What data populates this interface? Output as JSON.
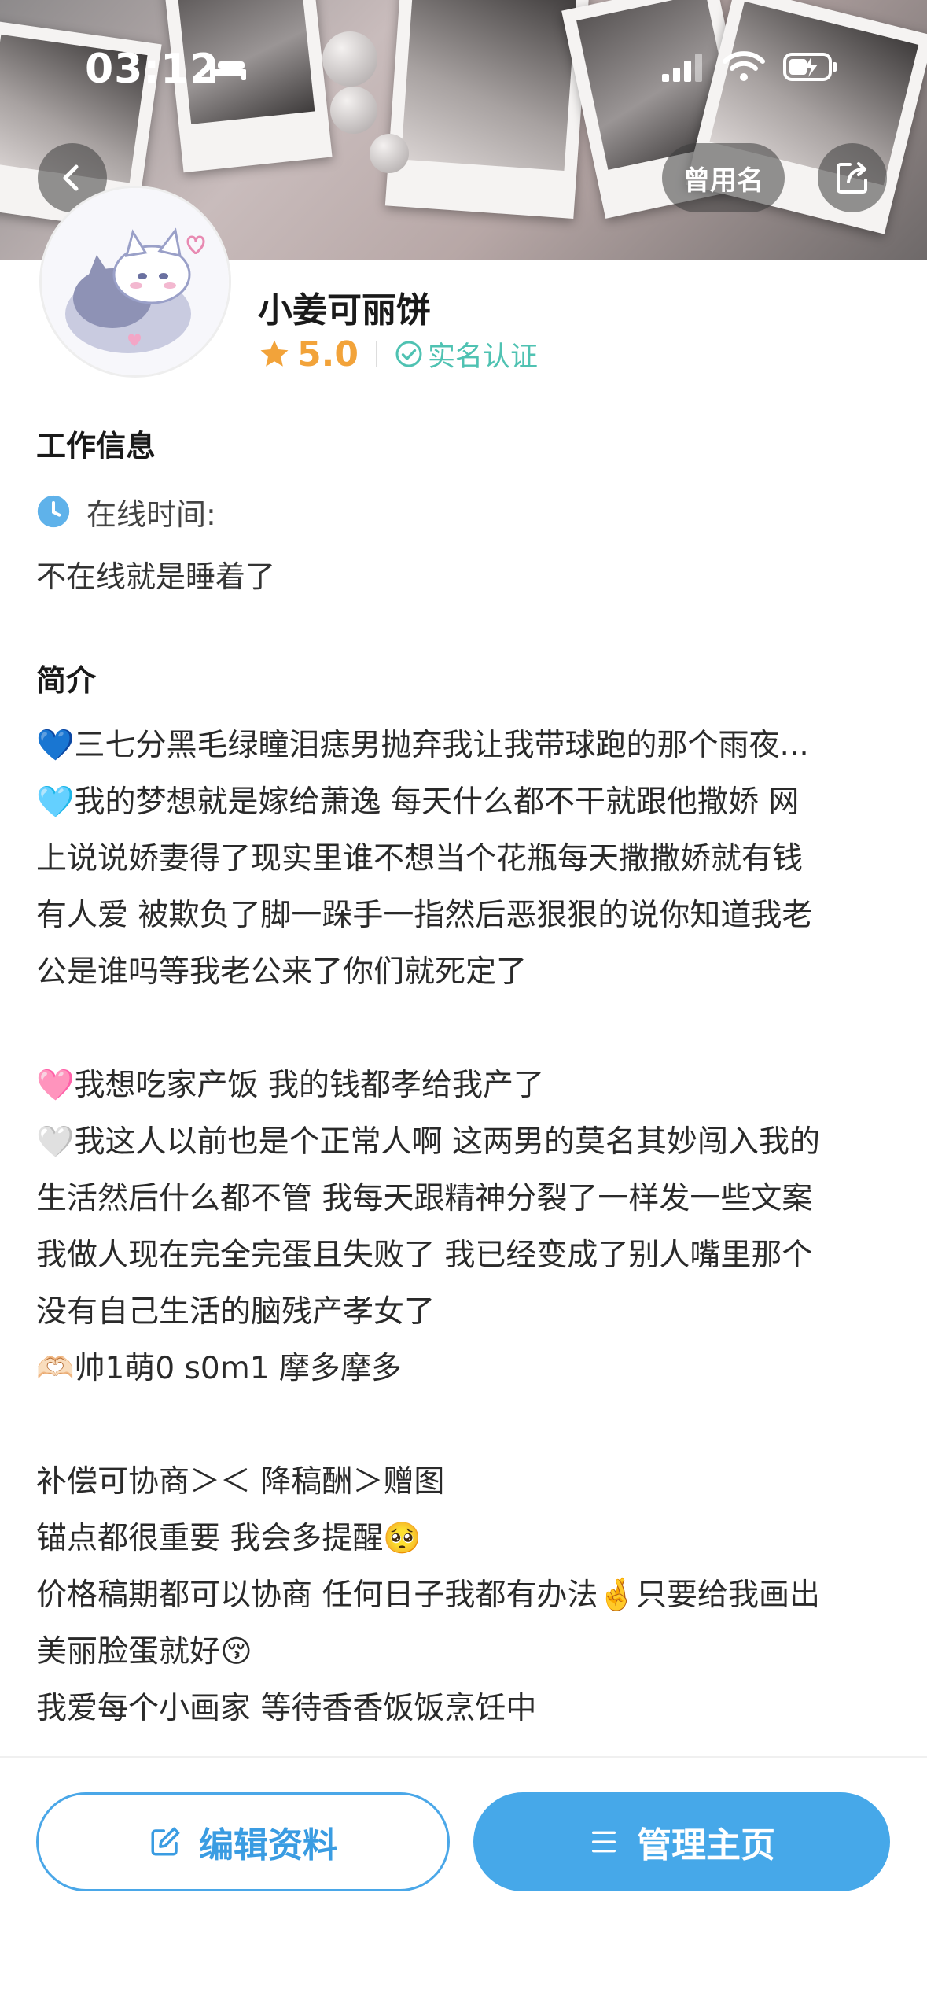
{
  "status_bar": {
    "time": "03:12"
  },
  "header": {
    "former_name_label": "曾用名"
  },
  "profile": {
    "name": "小姜可丽饼",
    "rating": "5.0",
    "verified_label": "实名认证"
  },
  "work_info": {
    "title": "工作信息",
    "online_label": "在线时间:",
    "online_value": "不在线就是睡着了"
  },
  "intro": {
    "title": "简介",
    "lines": [
      "💙三七分黑毛绿瞳泪痣男抛弃我让我带球跑的那个雨夜...",
      "🩵我的梦想就是嫁给萧逸 每天什么都不干就跟他撒娇 网",
      "上说说娇妻得了现实里谁不想当个花瓶每天撒撒娇就有钱",
      "有人爱 被欺负了脚一跺手一指然后恶狠狠的说你知道我老",
      "公是谁吗等我老公来了你们就死定了",
      "",
      "🩷我想吃家产饭 我的钱都孝给我产了",
      "🤍我这人以前也是个正常人啊 这两男的莫名其妙闯入我的",
      "生活然后什么都不管 我每天跟精神分裂了一样发一些文案",
      "我做人现在完全完蛋且失败了 我已经变成了别人嘴里那个",
      "没有自己生活的脑残产孝女了",
      "🫶🏻帅1萌0 s0m1 摩多摩多",
      "",
      "补偿可协商＞＜ 降稿酬＞赠图",
      "锚点都很重要 我会多提醒🥺",
      "价格稿期都可以协商 任何日子我都有办法🤞只要给我画出",
      "美丽脸蛋就好😚",
      "我爱每个小画家 等待香香饭饭烹饪中"
    ]
  },
  "actions": {
    "edit_label": "编辑资料",
    "manage_label": "管理主页"
  },
  "colors": {
    "accent_blue": "#46a8e9",
    "rating_orange": "#f2a33a",
    "verify_teal": "#4fc2b2"
  },
  "icons": [
    "bed-icon",
    "signal-icon",
    "wifi-icon",
    "battery-icon",
    "back-chevron-icon",
    "share-icon",
    "star-icon",
    "check-circle-icon",
    "clock-icon",
    "edit-icon",
    "menu-icon"
  ]
}
